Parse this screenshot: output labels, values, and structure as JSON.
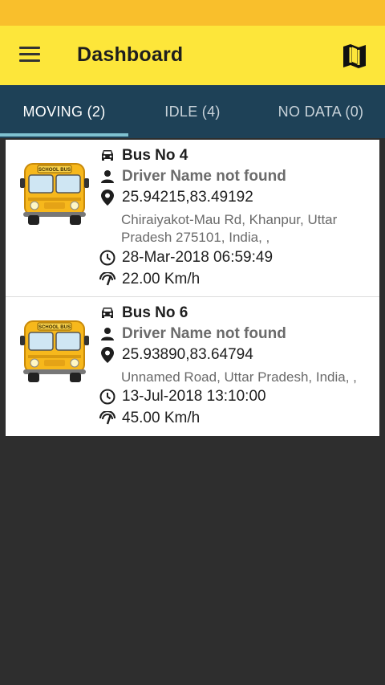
{
  "toolbar": {
    "title": "Dashboard",
    "menu_icon": "hamburger-menu-icon",
    "map_icon": "map-icon",
    "background": "#fde63a"
  },
  "status_bar": {
    "color": "#f9bf2c"
  },
  "tabs": [
    {
      "label": "MOVING (2)",
      "active": true
    },
    {
      "label": "IDLE (4)",
      "active": false
    },
    {
      "label": "NO DATA (0)",
      "active": false
    }
  ],
  "vehicles": [
    {
      "bus_no": "Bus No 4",
      "driver": "Driver Name not found",
      "coords": "25.94215,83.49192",
      "address": "Chiraiyakot-Mau Rd, Khanpur, Uttar Pradesh 275101, India, ,",
      "datetime": "28-Mar-2018 06:59:49",
      "speed": "22.00 Km/h",
      "bus_sign": "SCHOOL BUS"
    },
    {
      "bus_no": "Bus No 6",
      "driver": "Driver Name not found",
      "coords": "25.93890,83.64794",
      "address": "Unnamed Road, Uttar Pradesh, India, ,",
      "datetime": "13-Jul-2018 13:10:00",
      "speed": "45.00 Km/h",
      "bus_sign": "SCHOOL BUS"
    }
  ],
  "colors": {
    "tab_bar": "#1e4157",
    "tab_indicator": "#7fc1d0",
    "background": "#2e2e2e"
  }
}
